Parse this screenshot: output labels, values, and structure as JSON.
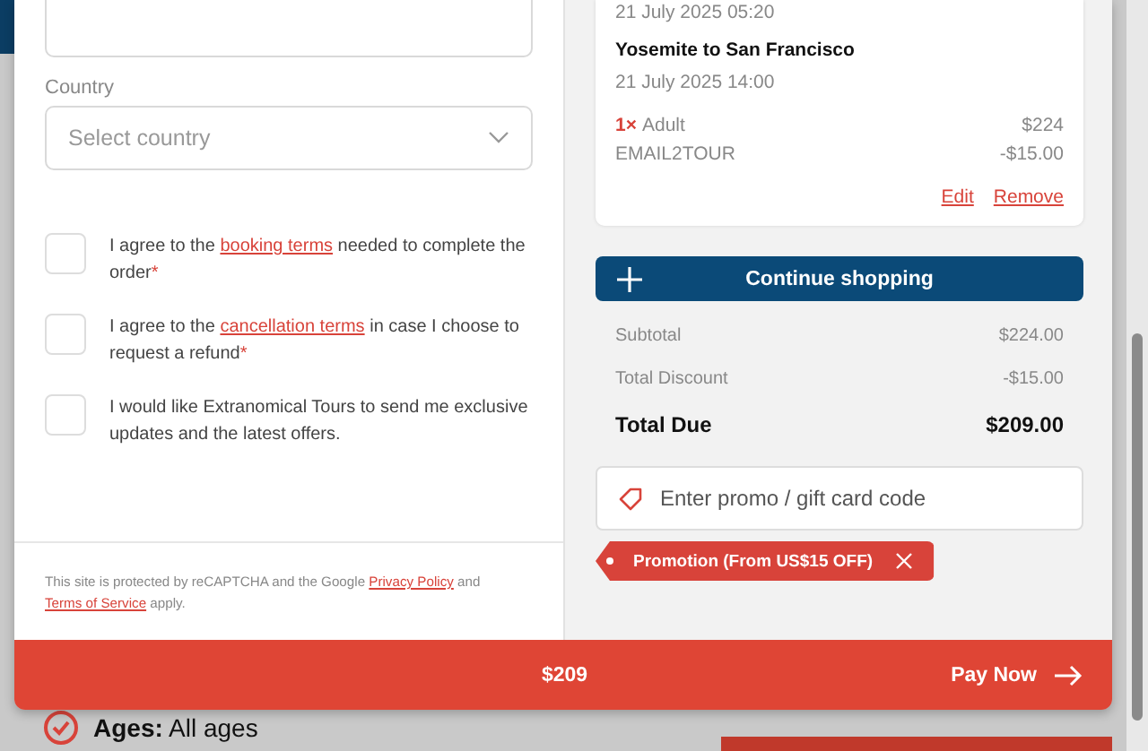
{
  "form": {
    "country": {
      "label": "Country",
      "placeholder": "Select country"
    },
    "consents": [
      {
        "before": "I agree to the ",
        "link": "booking terms",
        "after": " needed to complete the order",
        "mark": "*",
        "checked": false
      },
      {
        "before": "I agree to the ",
        "link": "cancellation terms",
        "after": " in case I choose to request a refund",
        "mark": "*",
        "checked": false
      },
      {
        "before": "I would like Extranomical Tours to send me exclusive updates and the latest offers.",
        "checked": false
      }
    ],
    "recaptcha": {
      "before": "This site is protected by reCAPTCHA and the Google ",
      "link1": "Privacy Policy",
      "middle": " and ",
      "link2": "Terms of Service",
      "after": " apply."
    }
  },
  "cart": {
    "previous_time": "21 July 2025 05:20",
    "title": "Yosemite to San Francisco",
    "date": "21 July 2025 14:00",
    "lines": [
      {
        "qty": "1×",
        "label": "Adult",
        "amount": "$224"
      },
      {
        "label": "EMAIL2TOUR",
        "amount": "-$15.00"
      }
    ],
    "actions": [
      "Edit",
      "Remove"
    ]
  },
  "continue_button": "Continue shopping",
  "totals": [
    {
      "label": "Subtotal",
      "value": "$224.00",
      "kind": "normal"
    },
    {
      "label": "Total Discount",
      "value": "-$15.00",
      "kind": "normal"
    },
    {
      "label": "Total Due",
      "value": "$209.00",
      "kind": "total"
    }
  ],
  "promo": {
    "placeholder": "Enter promo / gift card code",
    "tags": [
      {
        "label": "Promotion (From US$15 OFF)"
      }
    ]
  },
  "footer": {
    "amount": "$209",
    "pay": "Pay Now"
  },
  "background": {
    "ages_label": "Ages:",
    "ages_value": "All ages"
  }
}
